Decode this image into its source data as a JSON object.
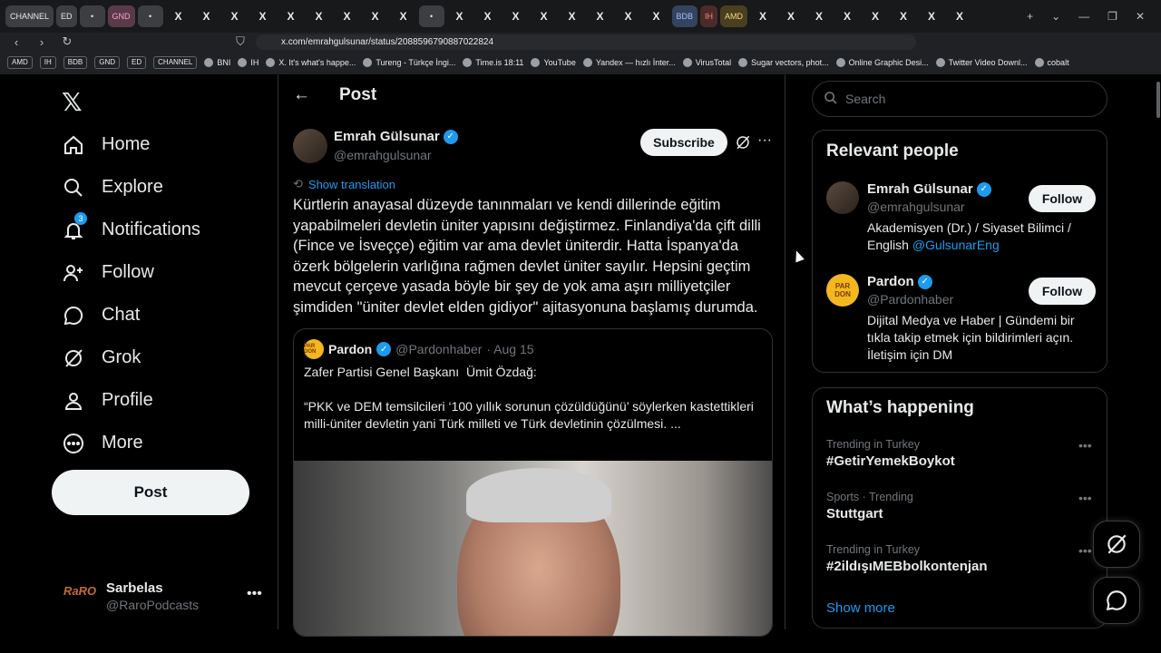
{
  "browser": {
    "tabs": [
      "CHANNEL",
      "ED",
      "",
      "GND",
      "",
      "X",
      "X",
      "X",
      "X",
      "X",
      "X",
      "X",
      "X",
      "X",
      "",
      "X",
      "X",
      "X",
      "X",
      "X",
      "X",
      "X",
      "X",
      "BDB",
      "IH",
      "AMD",
      "X",
      "X",
      "X",
      "X",
      "X",
      "X",
      "X",
      "X"
    ],
    "url": "x.com/emrahgulsunar/status/2088596790887022824",
    "bookmarks": [
      {
        "label": "AMD",
        "chip": true
      },
      {
        "label": "IH",
        "chip": true
      },
      {
        "label": "BDB",
        "chip": true
      },
      {
        "label": "GND",
        "chip": true
      },
      {
        "label": "ED",
        "chip": true
      },
      {
        "label": "CHANNEL",
        "chip": true
      },
      {
        "label": "BNI",
        "chip": false
      },
      {
        "label": "IH",
        "chip": false
      },
      {
        "label": "X. It's what's happe...",
        "chip": false
      },
      {
        "label": "Tureng - Türkçe İngi...",
        "chip": false
      },
      {
        "label": "Time.is 18:11",
        "chip": false
      },
      {
        "label": "YouTube",
        "chip": false
      },
      {
        "label": "Yandex — hızlı İnter...",
        "chip": false
      },
      {
        "label": "VirusTotal",
        "chip": false
      },
      {
        "label": "Sugar vectors, phot...",
        "chip": false
      },
      {
        "label": "Online Graphic Desi...",
        "chip": false
      },
      {
        "label": "Twitter Video Downl...",
        "chip": false
      },
      {
        "label": "cobalt",
        "chip": false
      }
    ]
  },
  "nav": {
    "items": [
      {
        "label": "Home",
        "icon": "home-icon"
      },
      {
        "label": "Explore",
        "icon": "search-icon"
      },
      {
        "label": "Notifications",
        "icon": "bell-icon",
        "badge": "3"
      },
      {
        "label": "Follow",
        "icon": "person-plus-icon"
      },
      {
        "label": "Chat",
        "icon": "chat-icon"
      },
      {
        "label": "Grok",
        "icon": "grok-icon"
      },
      {
        "label": "Profile",
        "icon": "person-icon"
      },
      {
        "label": "More",
        "icon": "more-circle-icon"
      }
    ],
    "post_label": "Post"
  },
  "account": {
    "avatar_text": "RaRO",
    "name": "Sarbelas",
    "handle": "@RaroPodcasts"
  },
  "header": {
    "title": "Post"
  },
  "tweet": {
    "author_name": "Emrah Gülsunar",
    "author_handle": "@emrahgulsunar",
    "subscribe_label": "Subscribe",
    "show_translation": "Show translation",
    "text": "Kürtlerin anayasal düzeyde tanınmaları ve kendi dillerinde eğitim yapabilmeleri devletin üniter yapısını değiştirmez. Finlandiya'da çift dilli (Fince ve İsveççe) eğitim var ama devlet üniterdir. Hatta İspanya'da özerk bölgelerin varlığına rağmen devlet üniter sayılır. Hepsini geçtim mevcut çerçeve yasada böyle bir şey de yok ama aşırı milliyetçiler şimdiden \"üniter devlet elden gidiyor\" ajitasyonuna başlamış durumda.",
    "quote": {
      "avatar_text": "PAR DON",
      "name": "Pardon",
      "handle": "@Pardonhaber",
      "date": "· Aug 15",
      "text": "Zafer Partisi Genel Başkanı  Ümit Özdağ:\n\n“PKK ve DEM temsilcileri ‘100 yıllık sorunun çözüldüğünü’ söylerken kastettikleri milli-üniter devletin yani Türk milleti ve Türk devletinin çözülmesi. ..."
    }
  },
  "search": {
    "placeholder": "Search"
  },
  "relevant": {
    "title": "Relevant people",
    "people": [
      {
        "name": "Emrah Gülsunar",
        "handle": "@emrahgulsunar",
        "bio": "Akademisyen (Dr.) / Siyaset Bilimci / English ",
        "bio_link": "@GulsunarEng",
        "follow": "Follow"
      },
      {
        "name": "Pardon",
        "handle": "@Pardonhaber",
        "avatar_text": "PAR DON",
        "bio": "Dijital Medya ve Haber | Gündemi bir tıkla takip etmek için bildirimleri açın. İletişim için DM",
        "bio_link": "",
        "follow": "Follow"
      }
    ]
  },
  "happening": {
    "title": "What’s happening",
    "trends": [
      {
        "context": "Trending in Turkey",
        "title": "#GetirYemekBoykot"
      },
      {
        "context": "Sports · Trending",
        "title": "Stuttgart"
      },
      {
        "context": "Trending in Turkey",
        "title": "#2ildışıMEBbolkontenjan"
      }
    ],
    "show_more": "Show more"
  },
  "colors": {
    "accent": "#1d9bf0",
    "border": "#2f3336",
    "muted": "#71767b"
  }
}
